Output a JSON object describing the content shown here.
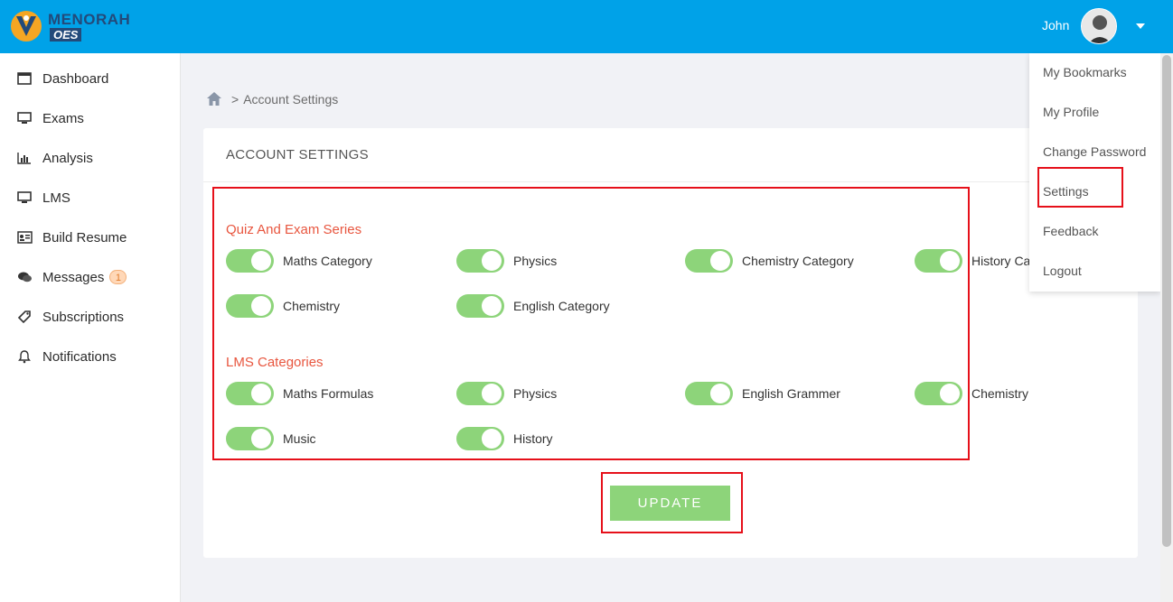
{
  "header": {
    "logo_text": "MENORAH",
    "logo_sub": "OES",
    "user_name": "John"
  },
  "sidebar": {
    "items": [
      {
        "label": "Dashboard",
        "icon": "dashboard-icon"
      },
      {
        "label": "Exams",
        "icon": "monitor-icon"
      },
      {
        "label": "Analysis",
        "icon": "bar-chart-icon"
      },
      {
        "label": "LMS",
        "icon": "monitor-icon"
      },
      {
        "label": "Build Resume",
        "icon": "id-card-icon"
      },
      {
        "label": "Messages",
        "icon": "chat-icon",
        "badge": "1"
      },
      {
        "label": "Subscriptions",
        "icon": "tag-icon"
      },
      {
        "label": "Notifications",
        "icon": "bell-icon"
      }
    ]
  },
  "breadcrumb": {
    "separator": ">",
    "current": "Account Settings"
  },
  "card": {
    "title": "ACCOUNT SETTINGS",
    "quiz_section": {
      "title": "Quiz And Exam Series",
      "items": [
        "Maths Category",
        "Physics",
        "Chemistry Category",
        "History Ca",
        "Chemistry",
        "English Category"
      ]
    },
    "lms_section": {
      "title": "LMS Categories",
      "items": [
        "Maths Formulas",
        "Physics",
        "English Grammer",
        "Chemistry",
        "Music",
        "History"
      ]
    },
    "update_label": "UPDATE"
  },
  "dropdown": {
    "items": [
      "My Bookmarks",
      "My Profile",
      "Change Password",
      "Settings",
      "Feedback",
      "Logout"
    ]
  },
  "colors": {
    "header_bg": "#00a2e8",
    "toggle_on": "#8dd47a",
    "section_title": "#e8563f",
    "highlight": "#e6101a"
  }
}
